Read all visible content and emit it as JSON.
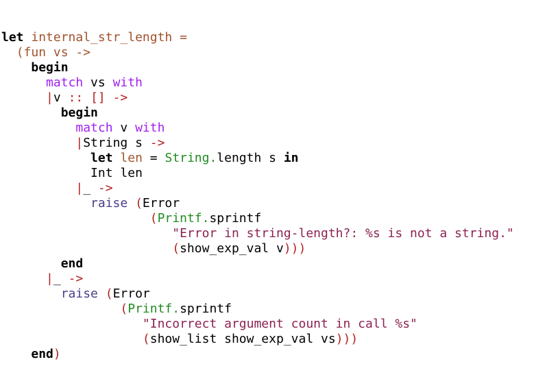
{
  "code": {
    "lines": [
      [
        {
          "t": "let",
          "c": "kw-bold"
        },
        {
          "t": " ",
          "c": "plain"
        },
        {
          "t": "internal_str_length =",
          "c": "fn-brown"
        }
      ],
      [
        {
          "t": "  ",
          "c": "plain"
        },
        {
          "t": "(fun vs ->",
          "c": "fn-brown"
        }
      ],
      [
        {
          "t": "    ",
          "c": "plain"
        },
        {
          "t": "begin",
          "c": "kw-bold"
        }
      ],
      [
        {
          "t": "      ",
          "c": "plain"
        },
        {
          "t": "match",
          "c": "kw-purple"
        },
        {
          "t": " vs ",
          "c": "plain"
        },
        {
          "t": "with",
          "c": "kw-purple"
        }
      ],
      [
        {
          "t": "      ",
          "c": "plain"
        },
        {
          "t": "|",
          "c": "kw-red"
        },
        {
          "t": "v ",
          "c": "plain"
        },
        {
          "t": ":: [] ->",
          "c": "kw-red"
        }
      ],
      [
        {
          "t": "        ",
          "c": "plain"
        },
        {
          "t": "begin",
          "c": "kw-bold"
        }
      ],
      [
        {
          "t": "          ",
          "c": "plain"
        },
        {
          "t": "match",
          "c": "kw-purple"
        },
        {
          "t": " v ",
          "c": "plain"
        },
        {
          "t": "with",
          "c": "kw-purple"
        }
      ],
      [
        {
          "t": "          ",
          "c": "plain"
        },
        {
          "t": "|",
          "c": "kw-red"
        },
        {
          "t": "String s ",
          "c": "plain"
        },
        {
          "t": "->",
          "c": "kw-red"
        }
      ],
      [
        {
          "t": "            ",
          "c": "plain"
        },
        {
          "t": "let",
          "c": "kw-bold"
        },
        {
          "t": " ",
          "c": "plain"
        },
        {
          "t": "len",
          "c": "fn-brown"
        },
        {
          "t": " = ",
          "c": "plain"
        },
        {
          "t": "String.",
          "c": "mod"
        },
        {
          "t": "length s ",
          "c": "plain"
        },
        {
          "t": "in",
          "c": "kw-bold"
        }
      ],
      [
        {
          "t": "            ",
          "c": "plain"
        },
        {
          "t": "Int len",
          "c": "plain"
        }
      ],
      [
        {
          "t": "          ",
          "c": "plain"
        },
        {
          "t": "|",
          "c": "kw-red"
        },
        {
          "t": "_ ",
          "c": "plain"
        },
        {
          "t": "->",
          "c": "kw-red"
        }
      ],
      [
        {
          "t": "            ",
          "c": "plain"
        },
        {
          "t": "raise",
          "c": "builtin"
        },
        {
          "t": " ",
          "c": "plain"
        },
        {
          "t": "(",
          "c": "paren"
        },
        {
          "t": "Error",
          "c": "plain"
        }
      ],
      [
        {
          "t": "                    ",
          "c": "plain"
        },
        {
          "t": "(",
          "c": "paren"
        },
        {
          "t": "Printf.",
          "c": "mod"
        },
        {
          "t": "sprintf",
          "c": "plain"
        }
      ],
      [
        {
          "t": "                       ",
          "c": "plain"
        },
        {
          "t": "\"Error in string-length?: %s is not a string.\"",
          "c": "str"
        }
      ],
      [
        {
          "t": "                       ",
          "c": "plain"
        },
        {
          "t": "(",
          "c": "paren"
        },
        {
          "t": "show_exp_val v",
          "c": "plain"
        },
        {
          "t": ")))",
          "c": "paren"
        }
      ],
      [
        {
          "t": "        ",
          "c": "plain"
        },
        {
          "t": "end",
          "c": "kw-bold"
        }
      ],
      [
        {
          "t": "      ",
          "c": "plain"
        },
        {
          "t": "|",
          "c": "kw-red"
        },
        {
          "t": "_ ",
          "c": "plain"
        },
        {
          "t": "->",
          "c": "kw-red"
        }
      ],
      [
        {
          "t": "        ",
          "c": "plain"
        },
        {
          "t": "raise",
          "c": "builtin"
        },
        {
          "t": " ",
          "c": "plain"
        },
        {
          "t": "(",
          "c": "paren"
        },
        {
          "t": "Error",
          "c": "plain"
        }
      ],
      [
        {
          "t": "                ",
          "c": "plain"
        },
        {
          "t": "(",
          "c": "paren"
        },
        {
          "t": "Printf.",
          "c": "mod"
        },
        {
          "t": "sprintf",
          "c": "plain"
        }
      ],
      [
        {
          "t": "                   ",
          "c": "plain"
        },
        {
          "t": "\"Incorrect argument count in call %s\"",
          "c": "str"
        }
      ],
      [
        {
          "t": "                   ",
          "c": "plain"
        },
        {
          "t": "(",
          "c": "paren"
        },
        {
          "t": "show_list show_exp_val vs",
          "c": "plain"
        },
        {
          "t": ")))",
          "c": "paren"
        }
      ],
      [
        {
          "t": "    ",
          "c": "plain"
        },
        {
          "t": "end",
          "c": "kw-bold"
        },
        {
          "t": ")",
          "c": "paren"
        }
      ]
    ]
  }
}
